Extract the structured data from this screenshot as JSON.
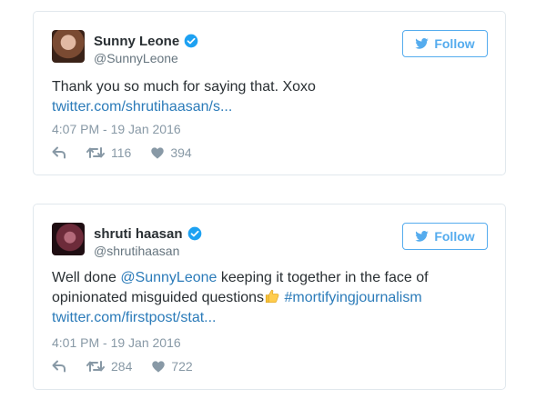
{
  "colors": {
    "accent": "#55acee",
    "link": "#2b7bb9",
    "verified": "#1da1f2",
    "text": "#292f33",
    "muted": "#8899a6",
    "border": "#e1e8ed"
  },
  "tweets": [
    {
      "display_name": "Sunny Leone",
      "handle": "@SunnyLeone",
      "verified_icon": "verified-badge-icon",
      "follow_label": "Follow",
      "text": "Thank you so much for saying that. Xoxo",
      "link_text": "twitter.com/shrutihaasan/s...",
      "timestamp": "4:07 PM - 19 Jan 2016",
      "retweets": "116",
      "likes": "394"
    },
    {
      "display_name": "shruti haasan",
      "handle": "@shrutihaasan",
      "verified_icon": "verified-badge-icon",
      "follow_label": "Follow",
      "text_before": "Well done ",
      "mention": "@SunnyLeone",
      "text_after": " keeping it together in the face of opinionated misguided questions",
      "emoji_icon": "thumbs-up-emoji-icon",
      "hashtag": "#mortifyingjournalism",
      "link_text": "twitter.com/firstpost/stat...",
      "timestamp": "4:01 PM - 19 Jan 2016",
      "retweets": "284",
      "likes": "722"
    }
  ]
}
